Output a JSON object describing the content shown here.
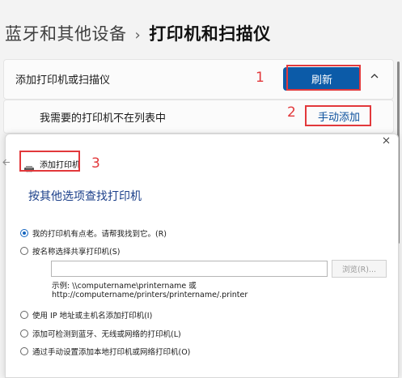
{
  "breadcrumb": {
    "parent": "蓝牙和其他设备",
    "separator": "›",
    "current": "打印机和扫描仪"
  },
  "add_card": {
    "label": "添加打印机或扫描仪",
    "refresh_button": "刷新",
    "collapse_icon": "chevron-up-icon"
  },
  "not_listed": {
    "label": "我需要的打印机不在列表中",
    "manual_add_button": "手动添加"
  },
  "annotations": [
    "1",
    "2",
    "3"
  ],
  "dialog": {
    "title": "添加打印机",
    "heading": "按其他选项查找打印机",
    "close_icon": "close-icon",
    "options": [
      {
        "label": "我的打印机有点老。请帮我找到它。(R)",
        "selected": true
      },
      {
        "label": "按名称选择共享打印机(S)",
        "selected": false
      },
      {
        "label": "使用 IP 地址或主机名添加打印机(I)",
        "selected": false
      },
      {
        "label": "添加可检测到蓝牙、无线或网络的打印机(L)",
        "selected": false
      },
      {
        "label": "通过手动设置添加本地打印机或网络打印机(O)",
        "selected": false
      }
    ],
    "share_input_value": "",
    "browse_button": "浏览(R)...",
    "example_line1": "示例: \\\\computername\\printername 或",
    "example_line2": "http://computername/printers/printername/.printer"
  },
  "colors": {
    "accent": "#0c5ba8",
    "annotation": "#e2383b",
    "heading": "#1b3f8a"
  }
}
